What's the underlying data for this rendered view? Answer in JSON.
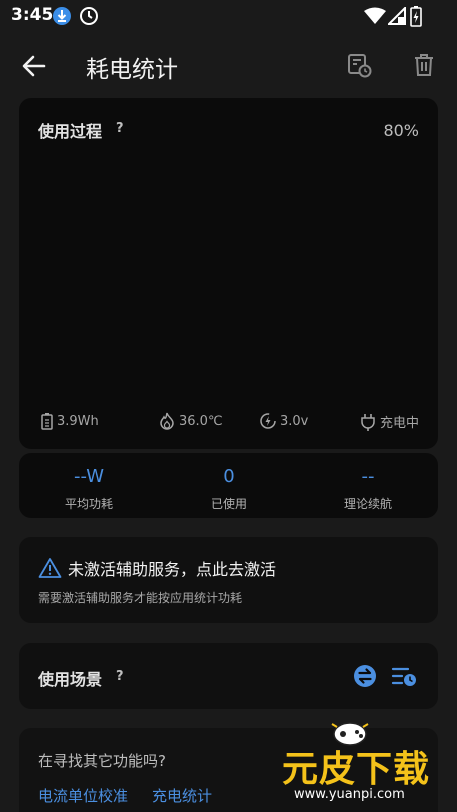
{
  "status_bar": {
    "time": "3:45",
    "icons": [
      "download-icon",
      "do-not-disturb-icon",
      "wifi-icon",
      "signal-icon",
      "battery-charging-icon"
    ]
  },
  "app_bar": {
    "title": "耗电统计",
    "icons": [
      "back-arrow-icon",
      "history-icon",
      "trash-icon"
    ]
  },
  "usage_card": {
    "label": "使用过程",
    "help": "?",
    "percent": "80%",
    "metrics": {
      "capacity": "3.9Wh",
      "temperature": "36.0℃",
      "voltage": "3.0v",
      "charging": "充电中"
    }
  },
  "stats": [
    {
      "value": "--W",
      "label": "平均功耗"
    },
    {
      "value": "0",
      "label": "已使用"
    },
    {
      "value": "--",
      "label": "理论续航"
    }
  ],
  "warning": {
    "title": "未激活辅助服务，点此去激活",
    "subtitle": "需要激活辅助服务才能按应用统计功耗"
  },
  "scene": {
    "label": "使用场景",
    "help": "?"
  },
  "more": {
    "question": "在寻找其它功能吗?",
    "links": [
      "电流单位校准",
      "充电统计"
    ]
  },
  "watermark": {
    "brand": "元皮下载",
    "url": "www.yuanpi.com"
  },
  "colors": {
    "accent": "#4b8fe0",
    "background": "#1a1a1a",
    "card": "#0b0b0b",
    "watermark": "#f4c21a"
  }
}
